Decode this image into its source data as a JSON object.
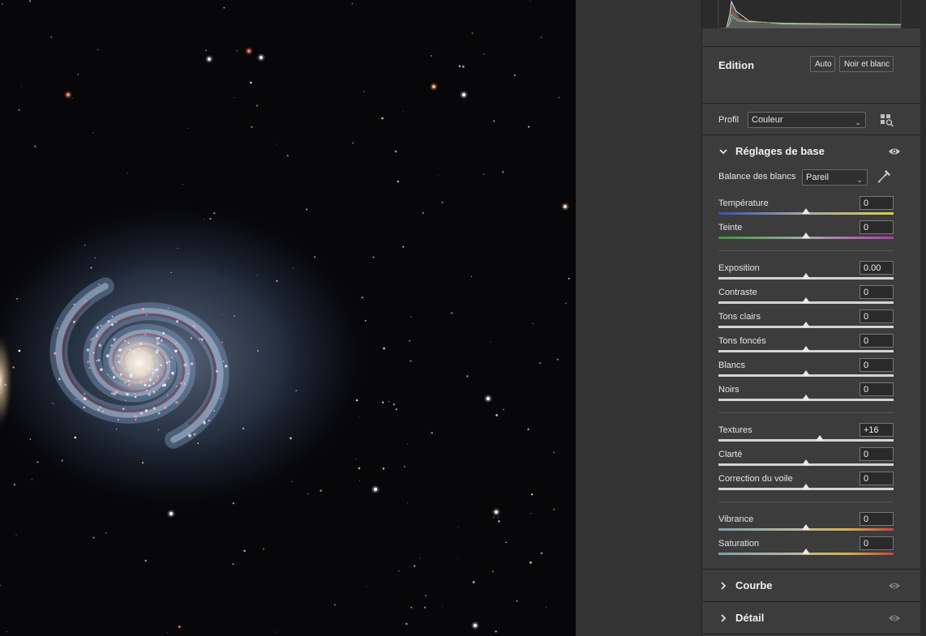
{
  "canvas": {
    "alt": "Whirlpool galaxy image"
  },
  "edit": {
    "title": "Edition",
    "auto_label": "Auto",
    "bw_label": "Noir et blanc"
  },
  "profile": {
    "label": "Profil",
    "value": "Couleur",
    "browser_icon": "profile-browser-icon"
  },
  "basic": {
    "title": "Réglages de base",
    "expanded": true,
    "wb_label": "Balance des blancs",
    "wb_value": "Pareil",
    "sliders": [
      {
        "label": "Température",
        "value": "0",
        "position": 0.5,
        "track": "temp"
      },
      {
        "label": "Teinte",
        "value": "0",
        "position": 0.5,
        "track": "tint"
      },
      {
        "label": "Exposition",
        "value": "0.00",
        "position": 0.5,
        "track": "plain"
      },
      {
        "label": "Contraste",
        "value": "0",
        "position": 0.5,
        "track": "plain"
      },
      {
        "label": "Tons clairs",
        "value": "0",
        "position": 0.5,
        "track": "plain"
      },
      {
        "label": "Tons foncés",
        "value": "0",
        "position": 0.5,
        "track": "plain"
      },
      {
        "label": "Blancs",
        "value": "0",
        "position": 0.5,
        "track": "plain"
      },
      {
        "label": "Noirs",
        "value": "0",
        "position": 0.5,
        "track": "plain"
      },
      {
        "label": "Textures",
        "value": "+16",
        "position": 0.58,
        "track": "plain"
      },
      {
        "label": "Clarté",
        "value": "0",
        "position": 0.5,
        "track": "plain"
      },
      {
        "label": "Correction du voile",
        "value": "0",
        "position": 0.5,
        "track": "plain"
      },
      {
        "label": "Vibrance",
        "value": "0",
        "position": 0.5,
        "track": "vib"
      },
      {
        "label": "Saturation",
        "value": "0",
        "position": 0.5,
        "track": "vib"
      }
    ]
  },
  "sections": {
    "curve": {
      "title": "Courbe"
    },
    "detail": {
      "title": "Détail"
    }
  },
  "colors": {
    "panel_bg": "#3c3c3c",
    "canvas_bg": "#070709",
    "text": "#e6e6e6"
  }
}
